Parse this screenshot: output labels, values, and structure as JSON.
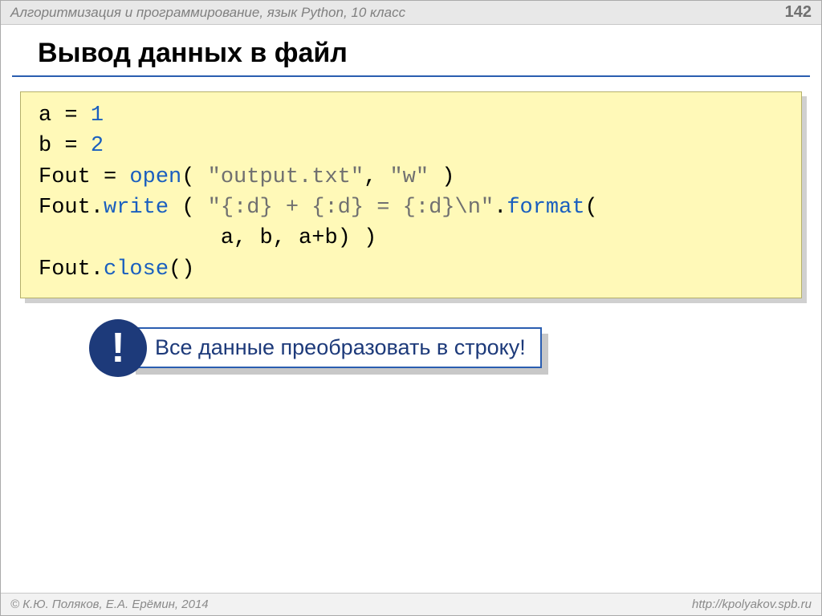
{
  "header": {
    "subject": "Алгоритмизация и программирование, язык Python, 10 класс",
    "page": "142"
  },
  "title": "Вывод данных в файл",
  "code": {
    "l1_a": "a = ",
    "l1_b": "1",
    "l2_a": "b = ",
    "l2_b": "2",
    "l3_a": "Fout = ",
    "l3_b": "open",
    "l3_c": "( ",
    "l3_d": "\"output.txt\"",
    "l3_e": ", ",
    "l3_f": "\"w\"",
    "l3_g": " )",
    "l4_a": "Fout.",
    "l4_b": "write",
    "l4_c": " ( ",
    "l4_d": "\"{:d} + {:d} = {:d}\\n\"",
    "l4_e": ".",
    "l4_f": "format",
    "l4_g": "(",
    "l5_a": "              a, b, a+b) )",
    "l6_a": "Fout.",
    "l6_b": "close",
    "l6_c": "()"
  },
  "callout": {
    "badge": "!",
    "text": "Все данные преобразовать в строку!"
  },
  "footer": {
    "left": "© К.Ю. Поляков, Е.А. Ерёмин, 2014",
    "right": "http://kpolyakov.spb.ru"
  }
}
